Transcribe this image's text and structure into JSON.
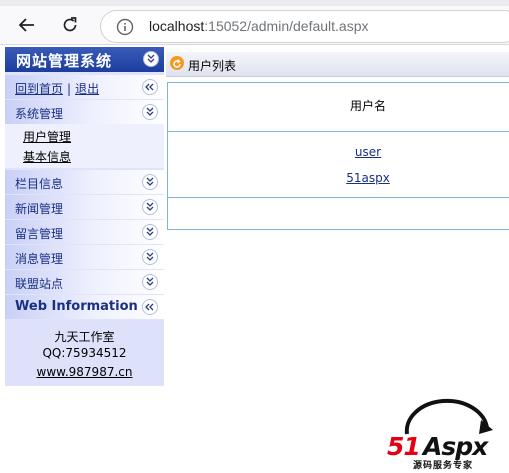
{
  "browser": {
    "url_host": "localhost",
    "url_rest": ":15052/admin/default.aspx"
  },
  "sidebar": {
    "title": "网站管理系统",
    "home_link": "回到首页",
    "separator": "|",
    "logout_link": "退出",
    "sections": [
      {
        "label": "系统管理"
      },
      {
        "label": "栏目信息"
      },
      {
        "label": "新闻管理"
      },
      {
        "label": "留言管理"
      },
      {
        "label": "消息管理"
      },
      {
        "label": "联盟站点"
      },
      {
        "label": "Web Information"
      }
    ],
    "sub_items": [
      "用户管理",
      "基本信息"
    ],
    "info": {
      "studio": "九天工作室",
      "qq": "QQ:75934512",
      "website": "www.987987.cn"
    }
  },
  "main": {
    "panel_title": "用户列表",
    "column_header": "用户名",
    "users": [
      "user",
      "51aspx"
    ]
  },
  "logo": {
    "brand": "51Aspx",
    "tagline": "源码服务专家"
  },
  "colors": {
    "sidebar_header": "#1c3d9e",
    "sidebar_bg": "#dfe3fb",
    "link": "#1a2f86",
    "grid_border": "#7fb6d8",
    "logo_red": "#e60012"
  }
}
